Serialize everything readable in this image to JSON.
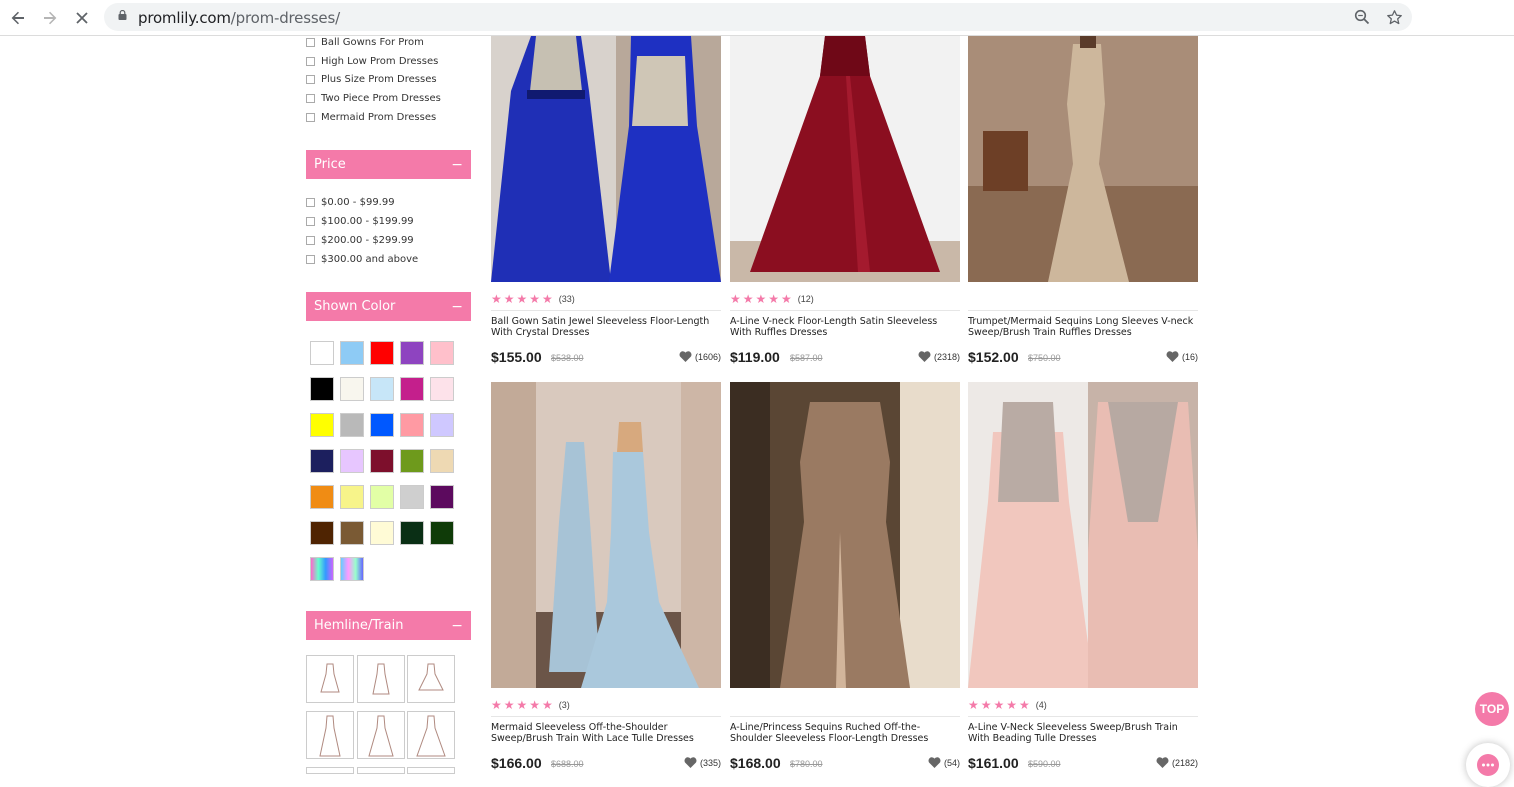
{
  "browser": {
    "url_host": "promlily.com",
    "url_path": "/prom-dresses/",
    "icons": [
      "back-arrow-icon",
      "forward-arrow-icon",
      "stop-loading-icon",
      "lock-icon",
      "zoom-icon",
      "star-bookmark-icon"
    ]
  },
  "sidebar": {
    "style_items": [
      "Ball Gowns For Prom",
      "High Low Prom Dresses",
      "Plus Size Prom Dresses",
      "Two Piece Prom Dresses",
      "Mermaid Prom Dresses"
    ],
    "price": {
      "title": "Price",
      "toggle": "−",
      "items": [
        "$0.00 - $99.99",
        "$100.00 - $199.99",
        "$200.00 - $299.99",
        "$300.00 and above"
      ]
    },
    "color": {
      "title": "Shown Color",
      "toggle": "−",
      "swatches": [
        "#ffffff",
        "#8ecbf5",
        "#ff0000",
        "#8e44c0",
        "#ffc0cb",
        "#000000",
        "#f8f6ee",
        "#c7e6f8",
        "#c41f8c",
        "#fde2ea",
        "#ffff00",
        "#b9b9b9",
        "#0058ff",
        "#ff9aa3",
        "#cfc8ff",
        "#1c1f5e",
        "#e7c6ff",
        "#7d0f2c",
        "#6e9a1c",
        "#eed9b3",
        "#f08c14",
        "#f7f48a",
        "#e2ffa6",
        "#cfcfcf",
        "#5c0a5e",
        "#4f2402",
        "#7a5a34",
        "#fffbd6",
        "#0a2f15",
        "#0f3b08",
        "rainbow-1",
        "rainbow-2"
      ]
    },
    "hemline": {
      "title": "Hemline/Train",
      "toggle": "−"
    }
  },
  "products": [
    {
      "rating_count": "(33)",
      "title": "Ball Gown Satin Jewel Sleeveless Floor-Length With Crystal Dresses",
      "price": "$155.00",
      "old_price": "$538.00",
      "likes": "(1606)",
      "rating": 5
    },
    {
      "rating_count": "(12)",
      "title": "A-Line V-neck Floor-Length Satin Sleeveless With Ruffles Dresses",
      "price": "$119.00",
      "old_price": "$587.00",
      "likes": "(2318)",
      "rating": 5
    },
    {
      "rating_count": "",
      "title": "Trumpet/Mermaid Sequins Long Sleeves V-neck Sweep/Brush Train Ruffles Dresses",
      "price": "$152.00",
      "old_price": "$750.00",
      "likes": "(16)",
      "rating": 0
    },
    {
      "rating_count": "(3)",
      "title": "Mermaid Sleeveless Off-the-Shoulder Sweep/Brush Train With Lace Tulle Dresses",
      "price": "$166.00",
      "old_price": "$688.00",
      "likes": "(335)",
      "rating": 5
    },
    {
      "rating_count": "",
      "title": "A-Line/Princess Sequins Ruched Off-the-Shoulder Sleeveless Floor-Length Dresses",
      "price": "$168.00",
      "old_price": "$780.00",
      "likes": "(54)",
      "rating": 0
    },
    {
      "rating_count": "(4)",
      "title": "A-Line V-Neck Sleeveless Sweep/Brush Train With Beading Tulle Dresses",
      "price": "$161.00",
      "old_price": "$590.00",
      "likes": "(2182)",
      "rating": 5
    }
  ],
  "floating": {
    "top_label": "TOP",
    "chat_icon": "chat-bubble-icon"
  },
  "colors": {
    "accent": "#f47aa9",
    "star": "#f47aa9"
  }
}
